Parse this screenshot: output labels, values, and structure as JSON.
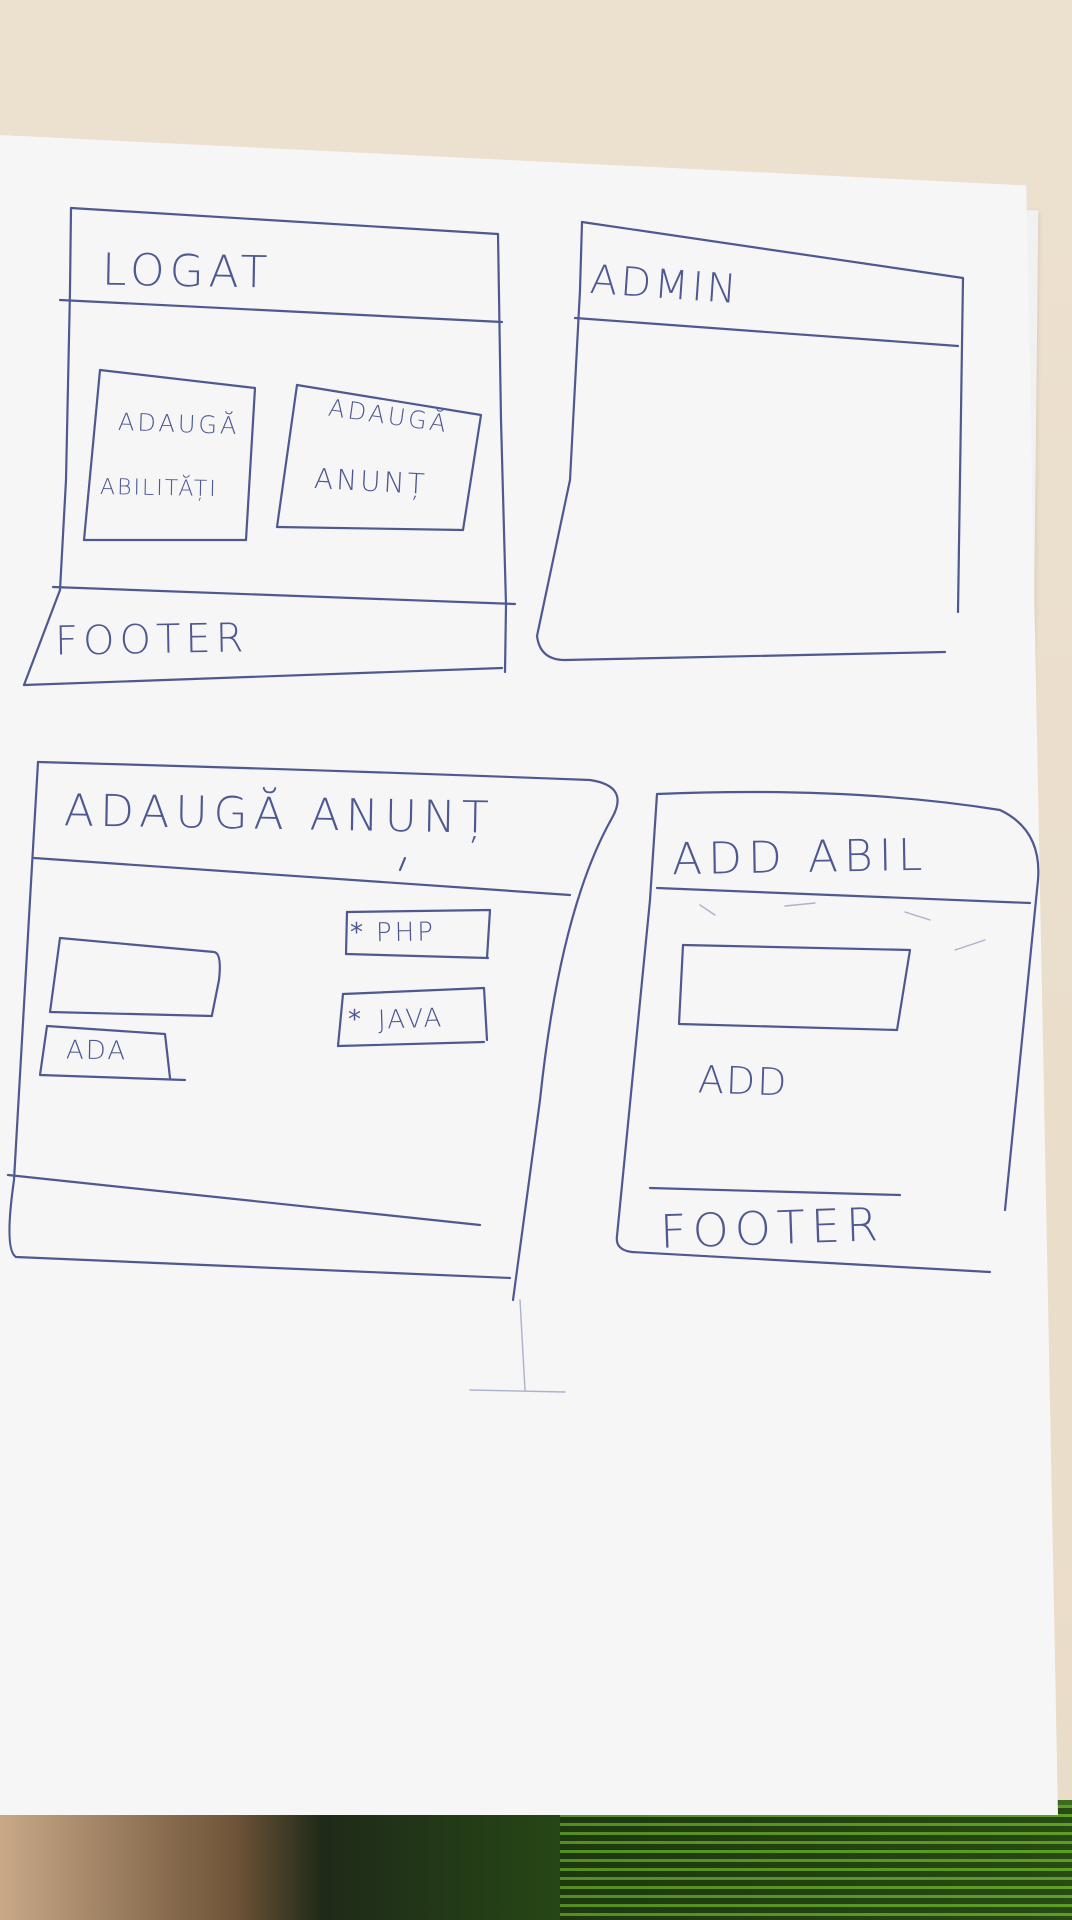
{
  "sketch": {
    "logged_in_screen": {
      "title": "LOGAT",
      "card_skills": {
        "line1": "ADAUGĂ",
        "line2": "ABILITĂȚI"
      },
      "card_ad": {
        "line1": "ADAUGĂ",
        "line2": "ANUNȚ"
      },
      "footer": "FOOTER"
    },
    "admin_screen": {
      "title": "ADMIN"
    },
    "add_ad_screen": {
      "title": "ADAUGĂ ANUNȚ",
      "button": "ADA",
      "options": [
        "PHP",
        "JAVA"
      ],
      "option_marker": "*"
    },
    "add_skill_screen": {
      "title": "ADD ABIL",
      "button": "ADD",
      "footer": "FOOTER"
    }
  },
  "colors": {
    "ink": "#4e5891",
    "paper": "#f6f6f7",
    "desk": "#ece0cf"
  }
}
